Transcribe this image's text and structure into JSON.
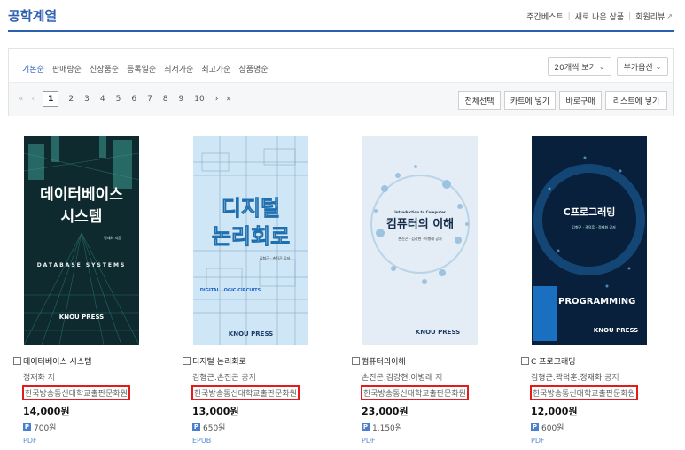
{
  "page": {
    "title": "공학계열",
    "links": [
      "주간베스트",
      "새로 나온 상품",
      "회원리뷰"
    ],
    "ext_icon": "↗"
  },
  "sort_tabs": [
    "기본순",
    "판매량순",
    "신상품순",
    "등록일순",
    "최저가순",
    "최고가순",
    "상품명순"
  ],
  "view_options": {
    "per_page": "20개씩 보기",
    "extra": "부가옵션"
  },
  "pager": {
    "first": "«",
    "prev": "‹",
    "pages": [
      "1",
      "2",
      "3",
      "4",
      "5",
      "6",
      "7",
      "8",
      "9",
      "10"
    ],
    "next": "›",
    "last": "»"
  },
  "actions": [
    "전체선택",
    "카트에 넣기",
    "바로구매",
    "리스트에 넣기"
  ],
  "books": [
    {
      "title": "데이터베이스 시스템",
      "author": "정재화",
      "role": "저",
      "publisher": "한국방송통신대학교출판문화원",
      "price": "14,000원",
      "points": "700원",
      "format": "PDF",
      "cover": {
        "main": "데이터베이스",
        "main2": "시스템",
        "sub": "DATABASE SYSTEMS",
        "small": "정재화 지음",
        "brand": "KNOU PRESS"
      }
    },
    {
      "title": "디지털 논리회로",
      "author": "김형근.손진곤",
      "role": "공저",
      "publisher": "한국방송통신대학교출판문화원",
      "price": "13,000원",
      "points": "650원",
      "format": "EPUB",
      "cover": {
        "main": "디지털",
        "main2": "논리회로",
        "sub": "DIGITAL LOGIC CIRCUITS",
        "small": "김형근 · 손진곤 공저",
        "brand": "KNOU PRESS"
      }
    },
    {
      "title": "컴퓨터의이해",
      "author": "손진곤.김강현.이병래",
      "role": "저",
      "publisher": "한국방송통신대학교출판문화원",
      "price": "23,000원",
      "points": "1,150원",
      "format": "PDF",
      "cover": {
        "main": "컴퓨터의 이해",
        "sub": "Introduction to Computer",
        "small": "손진곤 · 김강현 · 이병래 공저",
        "brand": "KNOU PRESS"
      }
    },
    {
      "title": "C 프로그래밍",
      "author": "김형근.곽덕훈.정재화",
      "role": "공저",
      "publisher": "한국방송통신대학교출판문화원",
      "price": "12,000원",
      "points": "600원",
      "format": "PDF",
      "cover": {
        "main": "C프로그래밍",
        "sub": "PROGRAMMING",
        "small": "김형근 · 곽덕훈 · 정재화 공저",
        "brand": "KNOU PRESS"
      }
    }
  ],
  "colors": {
    "accent": "#2b5fb0",
    "highlight_box": "#e31b1b",
    "points_badge": "#4a7fcf"
  },
  "icons": {
    "checkbox": "checkbox-icon",
    "points": "P",
    "chevron": "chevron-down-icon"
  }
}
